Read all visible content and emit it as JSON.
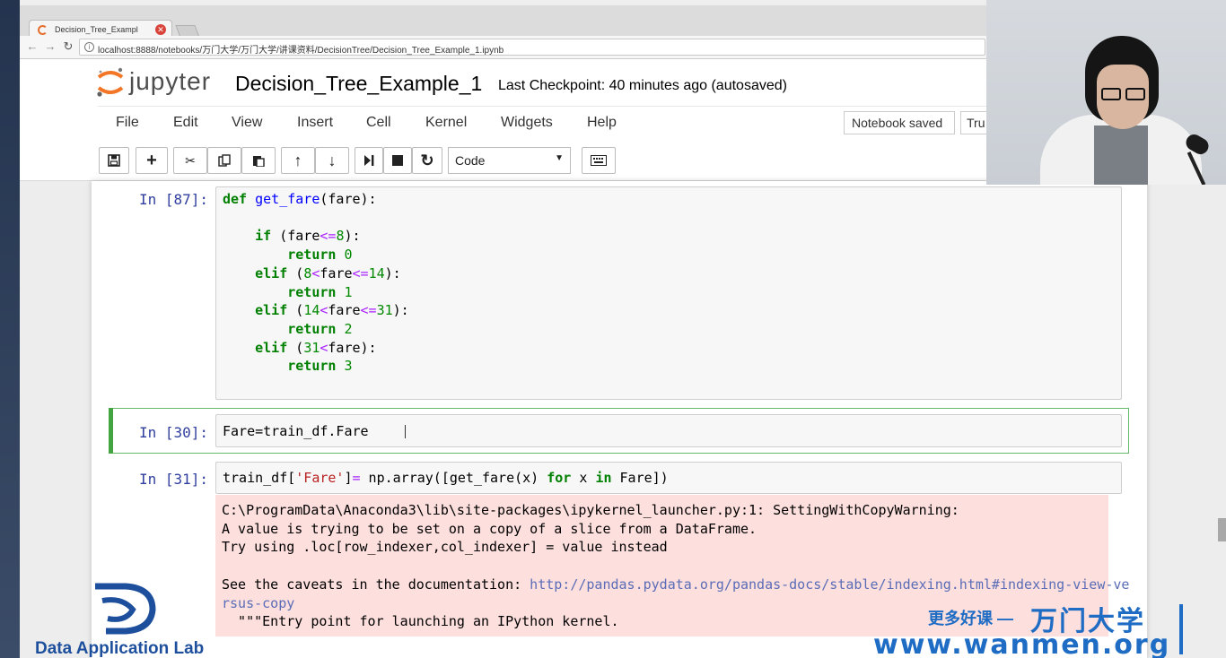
{
  "browser": {
    "tab_title": "Decision_Tree_Exampl",
    "tab_close": "✕",
    "url": "localhost:8888/notebooks/万门大学/万门大学/讲课资料/DecisionTree/Decision_Tree_Example_1.ipynb"
  },
  "header": {
    "logo_word": "jupyter",
    "notebook_name": "Decision_Tree_Example_1",
    "checkpoint": "Last Checkpoint: 40 minutes ago (autosaved)"
  },
  "menu": {
    "items": [
      "File",
      "Edit",
      "View",
      "Insert",
      "Cell",
      "Kernel",
      "Widgets",
      "Help"
    ],
    "notebook_saved": "Notebook saved",
    "trusted": "Tru"
  },
  "toolbar": {
    "cell_type": "Code"
  },
  "cells": [
    {
      "prompt": "In  [87]:",
      "lines": [
        "def get_fare(fare):",
        "",
        "    if (fare<=8):",
        "        return 0",
        "    elif (8<fare<=14):",
        "        return 1",
        "    elif (14<fare<=31):",
        "        return 2",
        "    elif (31<fare):",
        "        return 3"
      ]
    },
    {
      "prompt": "In  [30]:",
      "lines": [
        "Fare=train_df.Fare"
      ]
    },
    {
      "prompt": "In  [31]:",
      "lines": [
        "train_df['Fare']= np.array([get_fare(x) for x in Fare])"
      ]
    }
  ],
  "output": {
    "line1": "C:\\ProgramData\\Anaconda3\\lib\\site-packages\\ipykernel_launcher.py:1: SettingWithCopyWarning:",
    "line2": "A value is trying to be set on a copy of a slice from a DataFrame.",
    "line3": "Try using .loc[row_indexer,col_indexer] = value instead",
    "line5_prefix": "See the caveats in the documentation: ",
    "link_part1": "http://pandas.pydata.org/pandas-docs/stable/indexing.html#indexing-view-ve",
    "link_part2": "rsus-copy",
    "line7": "  \"\"\"Entry point for launching an IPython kernel."
  },
  "watermark": {
    "dal": "Data Application Lab",
    "cn_slogan": "更多好课 —",
    "cn_brand": "万门大学",
    "url": "www.wanmen.org"
  }
}
